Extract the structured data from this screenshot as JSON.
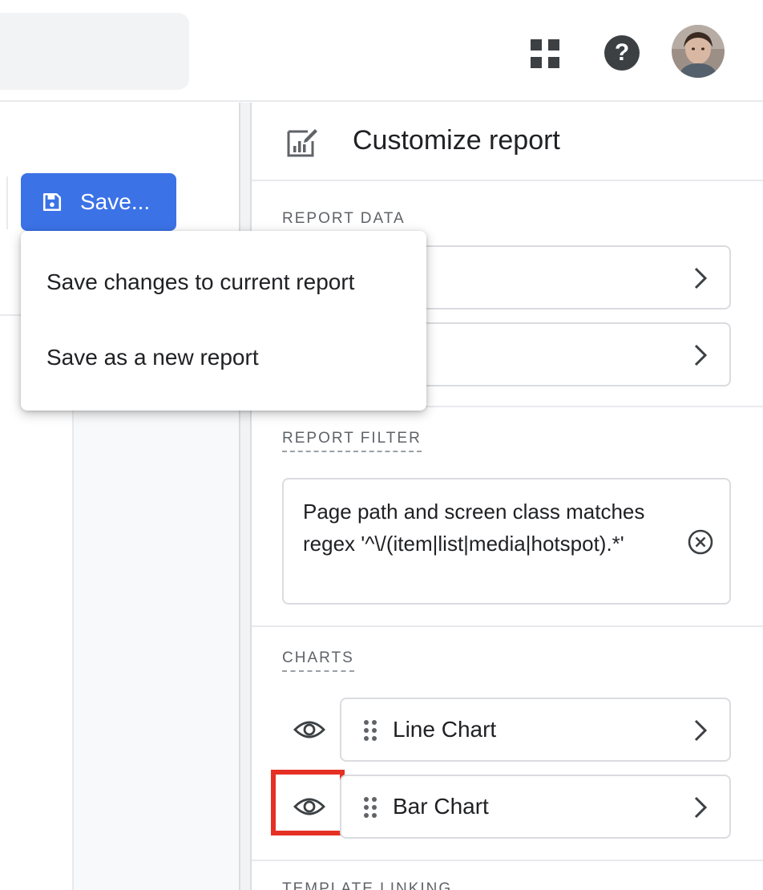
{
  "header": {
    "icons": {
      "apps": "apps-grid-icon",
      "help": "help-icon",
      "help_glyph": "?",
      "avatar": "avatar"
    }
  },
  "save": {
    "button_label": "Save...",
    "menu": {
      "items": [
        "Save changes to current report",
        "Save as a new report"
      ]
    }
  },
  "panel": {
    "title": "Customize report",
    "sections": {
      "report_data": {
        "label": "REPORT DATA"
      },
      "report_filter": {
        "label": "REPORT FILTER",
        "filter_text": "Page path and screen class matches regex '^\\/(item|list|media|hotspot).*'"
      },
      "charts": {
        "label": "CHARTS",
        "items": [
          {
            "label": "Line Chart",
            "visible": true
          },
          {
            "label": "Bar Chart",
            "visible": true
          }
        ]
      },
      "template_linking": {
        "label": "TEMPLATE LINKING"
      }
    }
  },
  "colors": {
    "accent": "#3b72e6",
    "highlight": "#e53024",
    "text": "#202124",
    "muted": "#5f6368"
  }
}
